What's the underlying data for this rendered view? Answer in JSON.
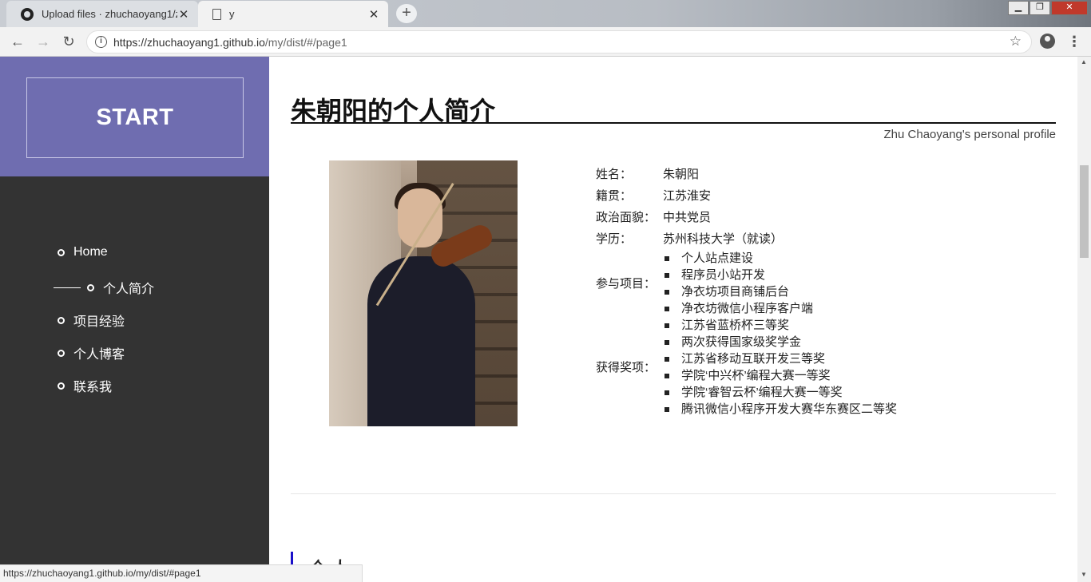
{
  "browser": {
    "tabs": [
      {
        "title": "Upload files · zhuchaoyang1/z",
        "icon": "github-icon"
      },
      {
        "title": "y",
        "icon": "document-icon"
      }
    ],
    "new_tab_label": "+",
    "url_host": "https://zhuchaoyang1.github.io",
    "url_path": "/my/dist/#/page1",
    "status_url": "https://zhuchaoyang1.github.io/my/dist/#page1"
  },
  "sidebar": {
    "start_label": "START",
    "items": [
      {
        "label": "Home",
        "active": false
      },
      {
        "label": "个人简介",
        "active": true
      },
      {
        "label": "项目经验",
        "active": false
      },
      {
        "label": "个人博客",
        "active": false
      },
      {
        "label": "联系我",
        "active": false
      }
    ]
  },
  "profile": {
    "title": "朱朝阳的个人简介",
    "subtitle": "Zhu Chaoyang's personal profile",
    "fields": [
      {
        "label": "姓名：",
        "value": "朱朝阳"
      },
      {
        "label": "籍贯：",
        "value": "江苏淮安"
      },
      {
        "label": "政治面貌：",
        "value": "中共党员"
      },
      {
        "label": "学历：",
        "value": "苏州科技大学（就读）"
      }
    ],
    "projects_label": "参与项目：",
    "projects": [
      "个人站点建设",
      "程序员小站开发",
      "净衣坊项目商铺后台",
      "净衣坊微信小程序客户端"
    ],
    "awards_label": "获得奖项：",
    "awards": [
      "江苏省蓝桥杯三等奖",
      "两次获得国家级奖学金",
      "江苏省移动互联开发三等奖",
      "学院‘中兴杯’编程大赛一等奖",
      "学院‘睿智云杯’编程大赛一等奖",
      "腾讯微信小程序开发大赛华东赛区二等奖"
    ],
    "next_section_heading": "个人"
  },
  "colors": {
    "sidebar_accent": "#6f6db0",
    "sidebar_bg": "#333333",
    "heading_bar": "#1a10c9"
  }
}
